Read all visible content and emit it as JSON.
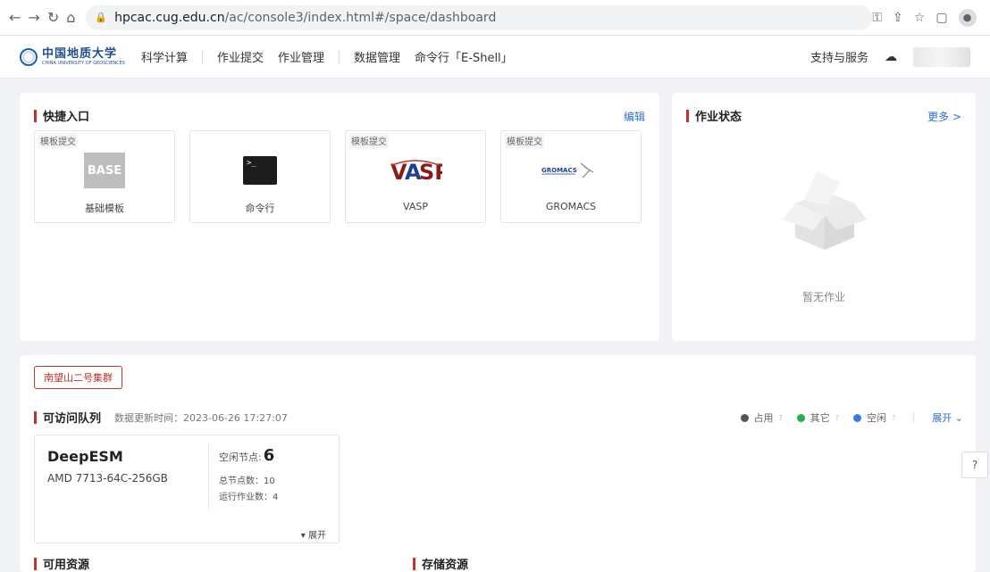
{
  "browser": {
    "url_host": "hpcac.cug.edu.cn",
    "url_path": "/ac/console3/index.html#/space/dashboard"
  },
  "header": {
    "logo_cn": "中国地质大学",
    "logo_en": "CHINA UNIVERSITY OF GEOSCIENCES",
    "menu": [
      "科学计算",
      "作业提交",
      "作业管理",
      "数据管理",
      "命令行「E-Shell」"
    ],
    "support": "支持与服务"
  },
  "quick": {
    "title": "快捷入口",
    "edit": "编辑",
    "cards": [
      {
        "tag": "模板提交",
        "icon_text": "BASE",
        "label": "基础模板"
      },
      {
        "tag": "",
        "icon_text": ">_",
        "label": "命令行"
      },
      {
        "tag": "模板提交",
        "icon_text": "VASP",
        "label": "VASP"
      },
      {
        "tag": "模板提交",
        "icon_text": "GROMACS",
        "label": "GROMACS"
      }
    ]
  },
  "status": {
    "title": "作业状态",
    "more": "更多 >",
    "empty": "暂无作业"
  },
  "cluster": {
    "button": "南望山二号集群",
    "queue_title": "可访问队列",
    "update_time": "数据更新时间：2023-06-26 17:27:07",
    "legend": [
      {
        "label": "占用",
        "color": "#555555"
      },
      {
        "label": "其它",
        "color": "#22b14c"
      },
      {
        "label": "空闲",
        "color": "#3b7be0"
      }
    ],
    "expand": "展开",
    "queue": {
      "name": "DeepESM",
      "spec": "AMD 7713-64C-256GB",
      "free_label": "空闲节点:",
      "free_value": "6",
      "total": "总节点数：10",
      "running": "运行作业数：4",
      "card_expand": "▾ 展开"
    }
  },
  "bottom": {
    "available": "可用资源",
    "storage": "存储资源"
  }
}
